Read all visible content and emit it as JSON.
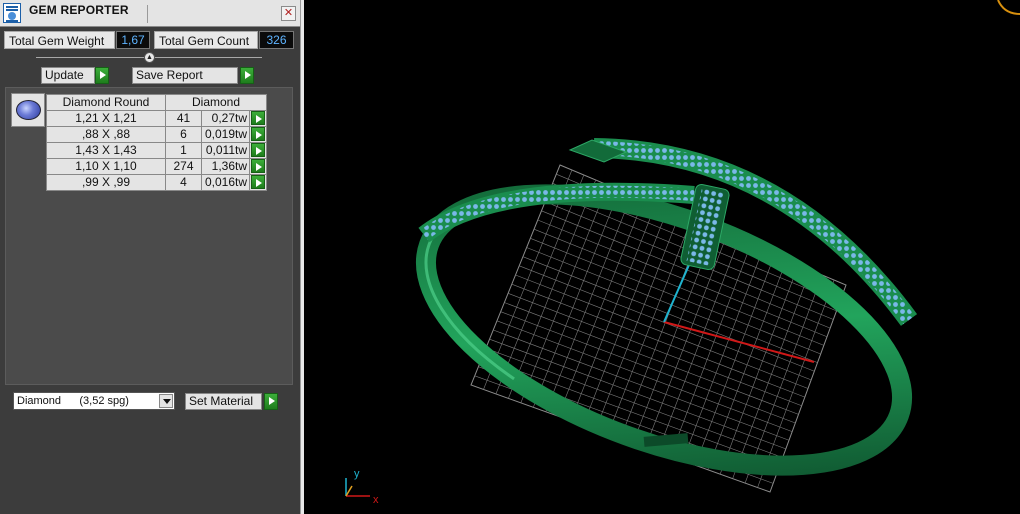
{
  "window": {
    "title": "GEM REPORTER",
    "close_icon": "close-icon"
  },
  "stats": {
    "weight_label": "Total Gem Weight",
    "weight_value": "1,67",
    "count_label": "Total Gem Count",
    "count_value": "326"
  },
  "actions": {
    "update_label": "Update",
    "save_label": "Save Report"
  },
  "table": {
    "headers": [
      "Diamond Round",
      "Diamond"
    ],
    "rows": [
      {
        "size": "1,21 X 1,21",
        "count": "41",
        "weight": "0,27tw"
      },
      {
        "size": ",88 X ,88",
        "count": "6",
        "weight": "0,019tw"
      },
      {
        "size": "1,43 X 1,43",
        "count": "1",
        "weight": "0,011tw"
      },
      {
        "size": "1,10 X 1,10",
        "count": "274",
        "weight": "1,36tw"
      },
      {
        "size": ",99 X ,99",
        "count": "4",
        "weight": "0,016tw"
      }
    ]
  },
  "material": {
    "selected": "Diamond      (3,52 spg)",
    "set_label": "Set Material"
  },
  "viewport": {
    "axis_y_label": "y",
    "axis_x_label": "x",
    "colors": {
      "ring": "#1d8a4e",
      "gem": "#7ab8e8",
      "grid": "#9a9a9a",
      "axis_x": "#d01818",
      "axis_y": "#1eb4d0"
    }
  }
}
